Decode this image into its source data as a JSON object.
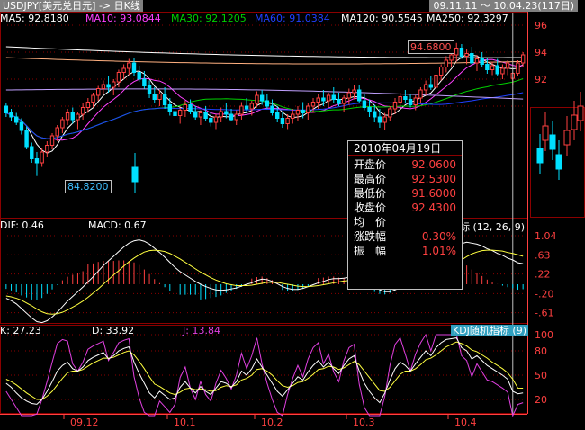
{
  "title": "USDJPY[美元兑日元] -> 日K线",
  "date_range": "09.11.11 ～ 10.04.23(117日)",
  "ma": [
    {
      "label": "MA5: 92.8180",
      "color": "#ffffff"
    },
    {
      "label": "MA10: 93.0844",
      "color": "#ff40ff"
    },
    {
      "label": "MA30: 92.1205",
      "color": "#00d000"
    },
    {
      "label": "MA60: 91.0384",
      "color": "#2040ff"
    },
    {
      "label": "MA120: 90.5545",
      "color": "#ffffff"
    },
    {
      "label": "MA250: 92.3297",
      "color": "#ffffff"
    }
  ],
  "high_label": "94.6800",
  "low_label": "84.8200",
  "macd_header": [
    {
      "label": "DIF: 0.46",
      "color": "#ffffff"
    },
    {
      "label": "MACD: 0.67",
      "color": "#ffffff"
    }
  ],
  "macd_indicator": "指标 (12, 26, 9)",
  "kdj_header": [
    {
      "label": "K: 27.23",
      "color": "#ffffff"
    },
    {
      "label": "D: 33.92",
      "color": "#ffffff"
    },
    {
      "label": "J: 13.84",
      "color": "#e040e0"
    }
  ],
  "kdj_indicator": "KDJ随机指标 (9)",
  "infobox": {
    "date": "2010年04月19日",
    "rows": [
      {
        "label": "开盘价",
        "value": "92.0600"
      },
      {
        "label": "最高价",
        "value": "92.5300"
      },
      {
        "label": "最低价",
        "value": "91.6000"
      },
      {
        "label": "收盘价",
        "value": "92.4300"
      },
      {
        "label": "均　价",
        "value": ""
      },
      {
        "label": "涨跌幅",
        "value": "0.30%"
      },
      {
        "label": "振　幅",
        "value": "1.01%"
      }
    ]
  },
  "colors": {
    "up": "#ff4040",
    "down": "#00e0ff",
    "grid": "#8b0000",
    "axis": "#ff4040"
  },
  "chart_data": [
    {
      "type": "candlestick",
      "title": "USDJPY 日K线",
      "x_ticks": [
        "09.12",
        "10.1",
        "10.2",
        "10.3",
        "10.4"
      ],
      "y_ticks": [
        96,
        94,
        92,
        90
      ],
      "ylim": [
        83,
        97
      ],
      "ohlc": [
        [
          90.0,
          90.2,
          89.2,
          89.5
        ],
        [
          89.5,
          89.8,
          88.9,
          89.2
        ],
        [
          89.2,
          89.5,
          88.6,
          88.8
        ],
        [
          88.8,
          89.1,
          87.9,
          88.2
        ],
        [
          88.2,
          88.5,
          86.8,
          87.0
        ],
        [
          87.0,
          87.3,
          85.8,
          86.1
        ],
        [
          86.1,
          86.6,
          84.82,
          85.8
        ],
        [
          85.8,
          86.9,
          85.5,
          86.6
        ],
        [
          86.6,
          87.4,
          86.2,
          87.1
        ],
        [
          87.1,
          88.0,
          86.8,
          87.8
        ],
        [
          87.8,
          88.6,
          87.4,
          88.4
        ],
        [
          88.4,
          89.2,
          88.0,
          89.0
        ],
        [
          89.0,
          89.8,
          88.6,
          89.5
        ],
        [
          89.5,
          89.9,
          88.7,
          89.0
        ],
        [
          89.0,
          89.6,
          88.3,
          89.4
        ],
        [
          89.4,
          90.2,
          89.0,
          89.9
        ],
        [
          89.9,
          90.6,
          89.5,
          90.3
        ],
        [
          90.3,
          91.0,
          89.9,
          90.8
        ],
        [
          90.8,
          91.5,
          90.4,
          91.3
        ],
        [
          91.3,
          91.9,
          90.9,
          91.6
        ],
        [
          91.6,
          92.2,
          91.0,
          91.4
        ],
        [
          91.4,
          92.0,
          90.8,
          91.8
        ],
        [
          91.8,
          92.7,
          91.4,
          92.5
        ],
        [
          92.5,
          93.1,
          92.0,
          92.8
        ],
        [
          92.8,
          93.5,
          92.3,
          93.2
        ],
        [
          93.2,
          93.6,
          92.2,
          92.5
        ],
        [
          92.5,
          93.0,
          91.8,
          92.0
        ],
        [
          92.0,
          92.6,
          91.3,
          91.5
        ],
        [
          91.5,
          91.9,
          90.6,
          90.9
        ],
        [
          90.9,
          91.4,
          90.2,
          90.5
        ],
        [
          90.5,
          91.2,
          90.0,
          90.9
        ],
        [
          90.9,
          91.4,
          89.8,
          90.1
        ],
        [
          90.1,
          90.6,
          89.3,
          89.6
        ],
        [
          89.6,
          90.1,
          88.9,
          89.3
        ],
        [
          89.3,
          89.9,
          88.7,
          89.7
        ],
        [
          89.7,
          90.4,
          89.2,
          90.1
        ],
        [
          90.1,
          90.5,
          89.4,
          89.6
        ],
        [
          89.6,
          90.0,
          89.0,
          89.2
        ],
        [
          89.2,
          89.7,
          88.6,
          89.5
        ],
        [
          89.5,
          90.0,
          88.9,
          89.1
        ],
        [
          89.1,
          89.6,
          88.5,
          88.8
        ],
        [
          88.8,
          89.4,
          88.3,
          89.2
        ],
        [
          89.2,
          89.9,
          88.8,
          89.6
        ],
        [
          89.6,
          90.2,
          89.1,
          89.4
        ],
        [
          89.4,
          89.8,
          88.9,
          89.0
        ],
        [
          89.0,
          89.7,
          88.6,
          89.4
        ],
        [
          89.4,
          90.3,
          89.0,
          90.0
        ],
        [
          90.0,
          90.6,
          89.5,
          89.8
        ],
        [
          89.8,
          90.4,
          89.3,
          90.2
        ],
        [
          90.2,
          91.1,
          89.9,
          90.8
        ],
        [
          90.8,
          91.2,
          90.1,
          90.4
        ],
        [
          90.4,
          90.9,
          89.8,
          90.0
        ],
        [
          90.0,
          90.5,
          89.3,
          89.5
        ],
        [
          89.5,
          90.0,
          88.8,
          89.1
        ],
        [
          89.1,
          89.6,
          88.4,
          88.7
        ],
        [
          88.7,
          89.4,
          88.3,
          89.1
        ],
        [
          89.1,
          89.8,
          88.7,
          89.4
        ],
        [
          89.4,
          90.0,
          88.9,
          89.7
        ],
        [
          89.7,
          90.3,
          89.1,
          89.5
        ],
        [
          89.5,
          90.2,
          89.0,
          90.0
        ],
        [
          90.0,
          90.6,
          89.5,
          90.3
        ],
        [
          90.3,
          90.9,
          89.8,
          90.6
        ],
        [
          90.6,
          91.2,
          90.0,
          90.4
        ],
        [
          90.4,
          91.0,
          89.9,
          90.8
        ],
        [
          90.8,
          91.4,
          90.2,
          90.5
        ],
        [
          90.5,
          91.0,
          90.0,
          90.2
        ],
        [
          90.2,
          90.8,
          89.6,
          90.6
        ],
        [
          90.6,
          91.3,
          90.1,
          91.0
        ],
        [
          91.0,
          91.6,
          90.5,
          91.2
        ],
        [
          91.2,
          91.6,
          90.2,
          90.4
        ],
        [
          90.4,
          90.9,
          89.7,
          89.9
        ],
        [
          89.9,
          90.5,
          89.2,
          89.6
        ],
        [
          89.6,
          90.1,
          88.8,
          89.2
        ],
        [
          89.2,
          89.8,
          88.4,
          88.8
        ],
        [
          88.8,
          89.5,
          88.2,
          89.2
        ],
        [
          89.2,
          90.0,
          88.9,
          89.8
        ],
        [
          89.8,
          90.6,
          89.4,
          90.3
        ],
        [
          90.3,
          91.0,
          89.9,
          90.7
        ],
        [
          90.7,
          91.2,
          90.2,
          90.5
        ],
        [
          90.5,
          90.9,
          89.9,
          90.1
        ],
        [
          90.1,
          90.8,
          89.7,
          90.6
        ],
        [
          90.6,
          91.4,
          90.2,
          91.2
        ],
        [
          91.2,
          91.9,
          90.8,
          91.6
        ],
        [
          91.6,
          92.2,
          91.2,
          91.4
        ],
        [
          91.4,
          92.6,
          91.0,
          92.3
        ],
        [
          92.3,
          93.1,
          91.9,
          92.9
        ],
        [
          92.9,
          93.7,
          92.5,
          93.4
        ],
        [
          93.4,
          94.1,
          92.9,
          93.8
        ],
        [
          93.8,
          94.68,
          93.3,
          94.3
        ],
        [
          94.3,
          94.6,
          93.5,
          93.7
        ],
        [
          93.7,
          94.2,
          93.1,
          93.9
        ],
        [
          93.9,
          94.4,
          93.0,
          93.2
        ],
        [
          93.2,
          93.8,
          92.6,
          93.5
        ],
        [
          93.5,
          94.0,
          92.9,
          93.1
        ],
        [
          93.1,
          93.6,
          92.4,
          92.7
        ],
        [
          92.7,
          93.3,
          92.3,
          93.0
        ],
        [
          93.0,
          93.5,
          92.2,
          92.4
        ],
        [
          92.4,
          93.1,
          92.0,
          92.8
        ],
        [
          92.8,
          93.4,
          92.3,
          93.2
        ],
        [
          92.06,
          92.53,
          91.6,
          92.43
        ],
        [
          92.43,
          93.4,
          92.2,
          93.2
        ],
        [
          93.2,
          94.0,
          92.9,
          93.8
        ]
      ]
    },
    {
      "type": "macd",
      "title": "MACD",
      "y_ticks": [
        1.04,
        0.63,
        0.22,
        -0.2,
        -0.61
      ],
      "dif": [
        -0.3,
        -0.35,
        -0.42,
        -0.52,
        -0.62,
        -0.72,
        -0.8,
        -0.82,
        -0.78,
        -0.7,
        -0.6,
        -0.48,
        -0.36,
        -0.26,
        -0.16,
        -0.06,
        0.05,
        0.16,
        0.28,
        0.4,
        0.5,
        0.6,
        0.7,
        0.8,
        0.88,
        0.93,
        0.95,
        0.92,
        0.86,
        0.77,
        0.68,
        0.58,
        0.47,
        0.36,
        0.27,
        0.2,
        0.13,
        0.06,
        0.0,
        -0.05,
        -0.09,
        -0.12,
        -0.13,
        -0.12,
        -0.1,
        -0.08,
        -0.04,
        0.0,
        0.03,
        0.08,
        0.11,
        0.1,
        0.06,
        0.01,
        -0.05,
        -0.09,
        -0.11,
        -0.11,
        -0.09,
        -0.05,
        -0.01,
        0.03,
        0.06,
        0.1,
        0.12,
        0.12,
        0.13,
        0.15,
        0.17,
        0.16,
        0.11,
        0.04,
        -0.04,
        -0.12,
        -0.16,
        -0.16,
        -0.12,
        -0.07,
        -0.02,
        0.0,
        0.04,
        0.1,
        0.18,
        0.24,
        0.33,
        0.44,
        0.56,
        0.68,
        0.8,
        0.87,
        0.9,
        0.88,
        0.86,
        0.82,
        0.76,
        0.72,
        0.66,
        0.62,
        0.56,
        0.52,
        0.46,
        0.44
      ],
      "dea": [
        -0.25,
        -0.27,
        -0.3,
        -0.34,
        -0.4,
        -0.46,
        -0.53,
        -0.59,
        -0.63,
        -0.64,
        -0.63,
        -0.6,
        -0.55,
        -0.49,
        -0.43,
        -0.36,
        -0.28,
        -0.19,
        -0.1,
        0.0,
        0.1,
        0.2,
        0.29,
        0.39,
        0.48,
        0.56,
        0.63,
        0.69,
        0.72,
        0.73,
        0.72,
        0.7,
        0.66,
        0.6,
        0.54,
        0.47,
        0.4,
        0.33,
        0.26,
        0.2,
        0.14,
        0.09,
        0.05,
        0.01,
        -0.01,
        -0.03,
        -0.03,
        -0.03,
        -0.02,
        0.0,
        0.02,
        0.04,
        0.04,
        0.04,
        0.02,
        0.0,
        -0.02,
        -0.04,
        -0.05,
        -0.05,
        -0.04,
        -0.03,
        -0.01,
        0.01,
        0.03,
        0.05,
        0.07,
        0.08,
        0.1,
        0.11,
        0.11,
        0.1,
        0.07,
        0.03,
        0.0,
        -0.03,
        -0.05,
        -0.05,
        -0.05,
        -0.04,
        -0.03,
        -0.01,
        0.03,
        0.07,
        0.12,
        0.18,
        0.26,
        0.34,
        0.43,
        0.52,
        0.59,
        0.65,
        0.69,
        0.72,
        0.73,
        0.73,
        0.72,
        0.71,
        0.68,
        0.66,
        0.63,
        0.6
      ]
    },
    {
      "type": "kdj",
      "title": "KDJ",
      "y_ticks": [
        100,
        80,
        50,
        20
      ],
      "k": [
        40,
        35,
        28,
        22,
        18,
        15,
        14,
        20,
        30,
        42,
        55,
        62,
        66,
        58,
        55,
        60,
        68,
        72,
        75,
        78,
        70,
        74,
        80,
        83,
        85,
        66,
        52,
        40,
        28,
        22,
        30,
        25,
        20,
        22,
        35,
        42,
        34,
        28,
        36,
        30,
        26,
        34,
        42,
        40,
        35,
        42,
        55,
        50,
        58,
        70,
        60,
        50,
        40,
        30,
        24,
        32,
        40,
        48,
        44,
        54,
        62,
        68,
        60,
        66,
        58,
        52,
        62,
        70,
        74,
        55,
        40,
        30,
        22,
        16,
        28,
        44,
        58,
        66,
        62,
        55,
        64,
        72,
        80,
        74,
        84,
        90,
        94,
        95,
        96,
        84,
        80,
        70,
        74,
        68,
        62,
        58,
        54,
        50,
        45,
        30,
        27,
        28
      ],
      "d": [
        45,
        42,
        38,
        33,
        28,
        24,
        20,
        20,
        24,
        30,
        38,
        46,
        53,
        55,
        55,
        57,
        61,
        65,
        68,
        71,
        71,
        72,
        75,
        78,
        80,
        75,
        67,
        58,
        48,
        39,
        36,
        32,
        28,
        26,
        29,
        33,
        34,
        32,
        33,
        32,
        30,
        31,
        35,
        37,
        36,
        38,
        44,
        46,
        50,
        57,
        58,
        55,
        50,
        43,
        37,
        35,
        37,
        41,
        42,
        46,
        51,
        57,
        58,
        61,
        60,
        57,
        59,
        63,
        67,
        63,
        55,
        47,
        39,
        31,
        30,
        35,
        43,
        51,
        55,
        55,
        58,
        63,
        69,
        71,
        75,
        80,
        85,
        88,
        91,
        89,
        86,
        81,
        79,
        75,
        71,
        66,
        62,
        58,
        53,
        45,
        34,
        33.9
      ],
      "j": [
        30,
        20,
        10,
        0,
        0,
        0,
        2,
        20,
        42,
        66,
        89,
        94,
        92,
        64,
        55,
        66,
        82,
        86,
        89,
        92,
        68,
        78,
        90,
        93,
        95,
        48,
        22,
        4,
        0,
        0,
        18,
        11,
        4,
        14,
        47,
        60,
        34,
        20,
        42,
        26,
        18,
        40,
        56,
        46,
        33,
        50,
        77,
        58,
        74,
        96,
        64,
        40,
        20,
        4,
        0,
        26,
        46,
        62,
        48,
        70,
        84,
        90,
        64,
        76,
        54,
        42,
        68,
        84,
        88,
        39,
        10,
        0,
        0,
        0,
        24,
        62,
        88,
        96,
        76,
        55,
        76,
        90,
        100,
        80,
        100,
        100,
        100,
        100,
        100,
        74,
        68,
        48,
        64,
        54,
        44,
        42,
        38,
        34,
        29,
        0,
        13.84,
        16
      ]
    }
  ]
}
